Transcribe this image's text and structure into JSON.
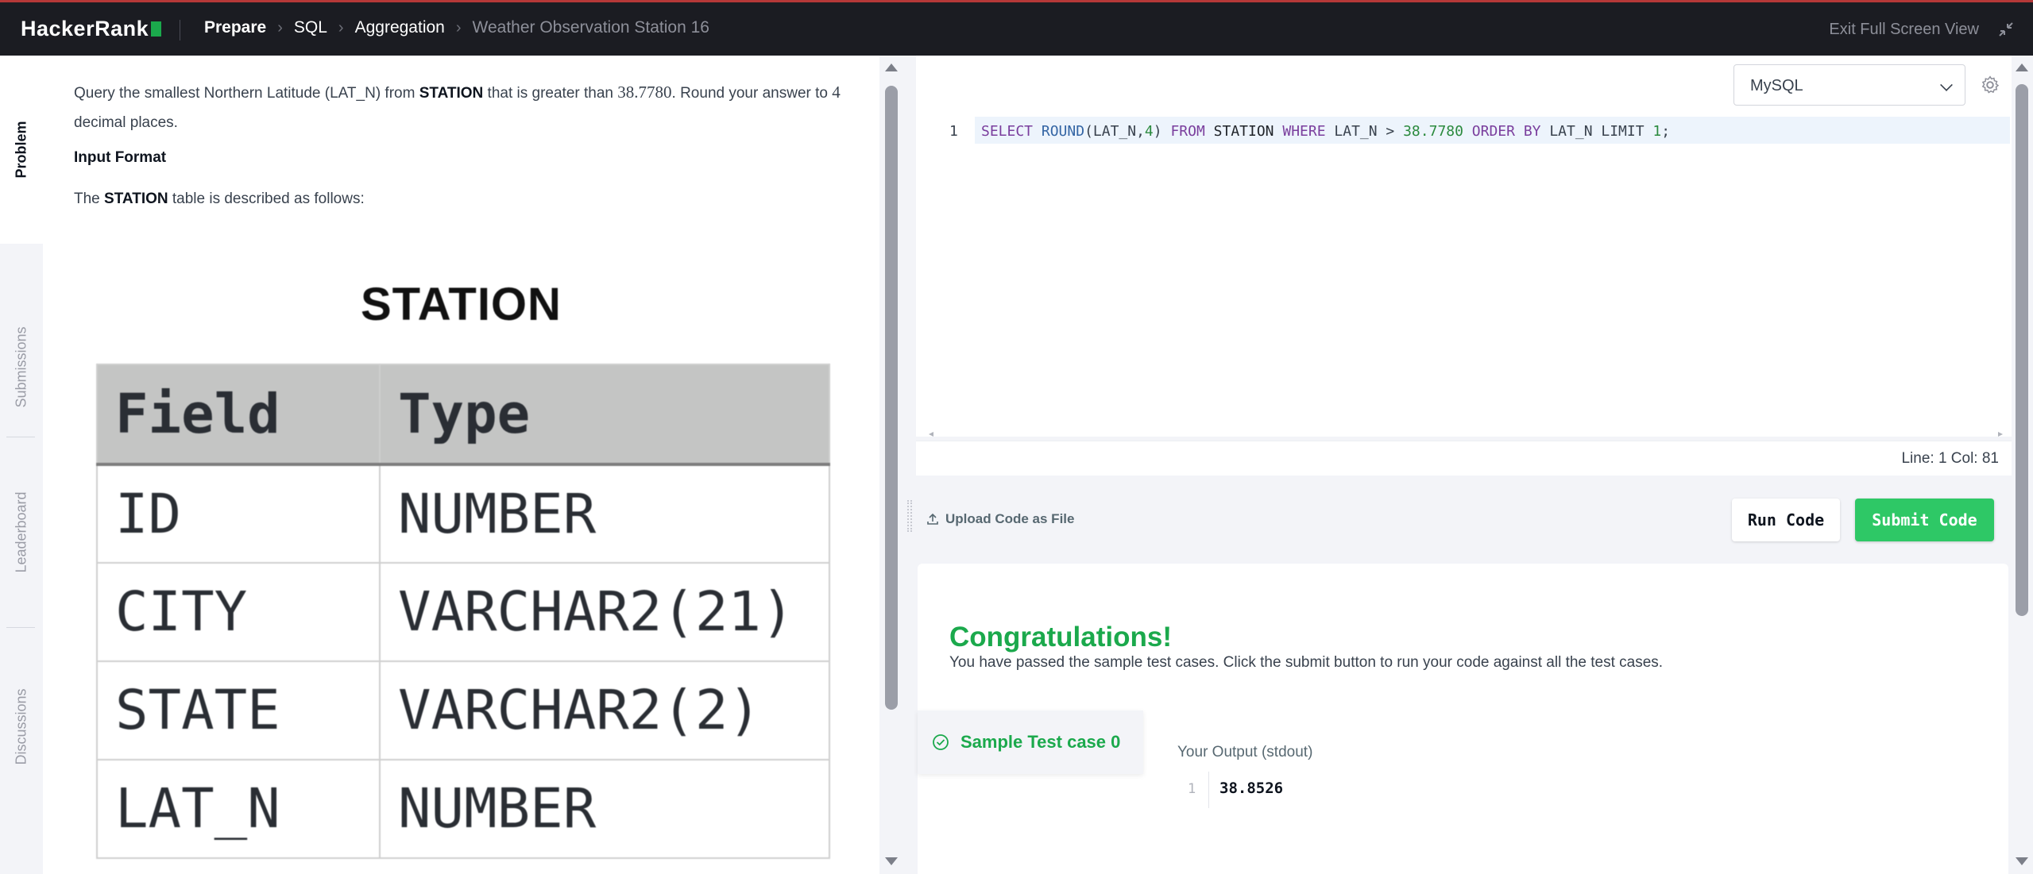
{
  "header": {
    "logo": "HackerRank",
    "breadcrumbs": [
      "Prepare",
      "SQL",
      "Aggregation",
      "Weather Observation Station 16"
    ],
    "exit_label": "Exit Full Screen View"
  },
  "sidebar": {
    "tabs": [
      {
        "label": "Problem",
        "active": true
      },
      {
        "label": "Submissions"
      },
      {
        "label": "Leaderboard"
      },
      {
        "label": "Discussions"
      }
    ]
  },
  "problem": {
    "text_1": "Query the smallest Northern Latitude (LAT_N) from ",
    "text_station": "STATION",
    "text_2": " that is greater than ",
    "text_value": "38.7780",
    "text_3": ". Round your answer to ",
    "text_places": "4",
    "text_4": " decimal places.",
    "input_format_heading": "Input Format",
    "desc_1": "The ",
    "desc_station": "STATION",
    "desc_2": " table is described as follows:",
    "table_title": "STATION",
    "table_headers": [
      "Field",
      "Type"
    ],
    "table_rows": [
      [
        "ID",
        "NUMBER"
      ],
      [
        "CITY",
        "VARCHAR2(21)"
      ],
      [
        "STATE",
        "VARCHAR2(2)"
      ],
      [
        "LAT_N",
        "NUMBER"
      ]
    ]
  },
  "editor": {
    "language": "MySQL",
    "line_number": "1",
    "code_tokens": {
      "t1": "SELECT",
      "t2": "ROUND",
      "t3": "(LAT_N,",
      "t4": "4",
      "t5": ")",
      "t6": "FROM",
      "t7": "STATION",
      "t8": "WHERE",
      "t9": "LAT_N >",
      "t10": "38.7780",
      "t11": "ORDER BY",
      "t12": "LAT_N LIMIT",
      "t13": "1",
      "t14": ";"
    },
    "status": "Line: 1 Col: 81"
  },
  "actions": {
    "upload_label": "Upload Code as File",
    "run_label": "Run Code",
    "submit_label": "Submit Code"
  },
  "results": {
    "title": "Congratulations!",
    "subtitle": "You have passed the sample test cases. Click the submit button to run your code against all the test cases.",
    "testcase_label": "Sample Test case 0",
    "output_label": "Your Output (stdout)",
    "output_line": "1",
    "output_value": "38.8526"
  },
  "colors": {
    "accent_green": "#1ba94c",
    "submit_green": "#2ec866",
    "topbar_bg": "#1b1c22"
  }
}
